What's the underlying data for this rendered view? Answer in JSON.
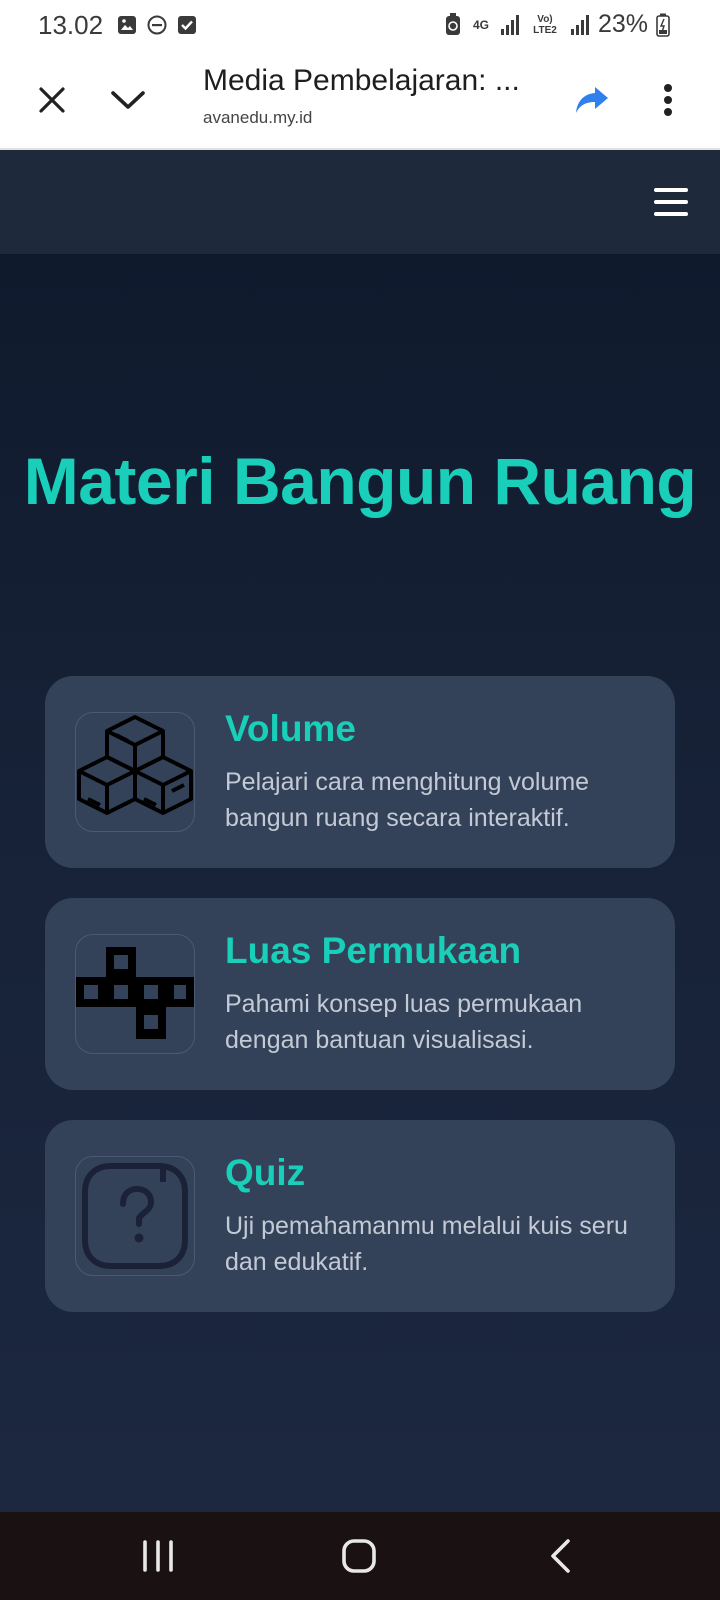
{
  "status_bar": {
    "time": "13.02",
    "network": "4G",
    "lte": "Vo) LTE2",
    "battery": "23%",
    "icons": [
      "image-icon",
      "dnd-icon",
      "checkbox-icon",
      "battery-saver-icon",
      "signal-icon",
      "battery-icon"
    ]
  },
  "browser": {
    "title": "Media Pembelajaran: ...",
    "url": "avanedu.my.id",
    "icons": [
      "close-icon",
      "chevron-down-icon",
      "share-icon",
      "more-vert-icon"
    ]
  },
  "nav": {
    "menu_icon": "hamburger-icon"
  },
  "main": {
    "title": "Materi Bangun Ruang",
    "cards": [
      {
        "title": "Volume",
        "description": "Pelajari cara menghitung volume bangun ruang secara interaktif.",
        "icon": "cubes-icon"
      },
      {
        "title": "Luas Permukaan",
        "description": "Pahami konsep luas permukaan dengan bantuan visualisasi.",
        "icon": "cube-net-icon"
      },
      {
        "title": "Quiz",
        "description": "Uji pemahamanmu melalui kuis seru dan edukatif.",
        "icon": "question-icon"
      }
    ]
  },
  "colors": {
    "accent": "#19cfb9",
    "card_bg": "#334258",
    "nav_bg": "#1e293b",
    "share": "#2f80ed"
  },
  "system_nav": {
    "icons": [
      "recents-icon",
      "home-icon",
      "back-icon"
    ]
  }
}
